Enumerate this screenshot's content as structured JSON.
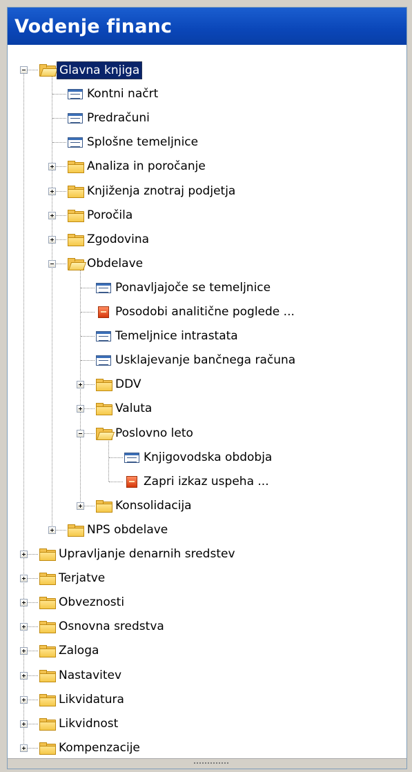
{
  "panel": {
    "title": "Vodenje financ"
  },
  "tree": {
    "items": [
      {
        "label": "Glavna knjiga",
        "level": 0,
        "kind": "folder-open",
        "expander": "minus",
        "selected": true
      },
      {
        "label": "Kontni načrt",
        "level": 1,
        "kind": "form"
      },
      {
        "label": "Predračuni",
        "level": 1,
        "kind": "form"
      },
      {
        "label": "Splošne temeljnice",
        "level": 1,
        "kind": "form"
      },
      {
        "label": "Analiza in poročanje",
        "level": 1,
        "kind": "folder",
        "expander": "plus"
      },
      {
        "label": "Knjiženja znotraj podjetja",
        "level": 1,
        "kind": "folder",
        "expander": "plus"
      },
      {
        "label": "Poročila",
        "level": 1,
        "kind": "folder",
        "expander": "plus"
      },
      {
        "label": "Zgodovina",
        "level": 1,
        "kind": "folder",
        "expander": "plus"
      },
      {
        "label": "Obdelave",
        "level": 1,
        "kind": "folder-open",
        "expander": "minus"
      },
      {
        "label": "Ponavljajoče se temeljnice",
        "level": 2,
        "kind": "form"
      },
      {
        "label": "Posodobi analitične poglede ...",
        "level": 2,
        "kind": "report"
      },
      {
        "label": "Temeljnice intrastata",
        "level": 2,
        "kind": "form"
      },
      {
        "label": "Usklajevanje bančnega  računa",
        "level": 2,
        "kind": "form"
      },
      {
        "label": "DDV",
        "level": 2,
        "kind": "folder",
        "expander": "plus"
      },
      {
        "label": "Valuta",
        "level": 2,
        "kind": "folder",
        "expander": "plus"
      },
      {
        "label": "Poslovno leto",
        "level": 2,
        "kind": "folder-open",
        "expander": "minus"
      },
      {
        "label": "Knjigovodska obdobja",
        "level": 3,
        "kind": "form"
      },
      {
        "label": "Zapri izkaz uspeha ...",
        "level": 3,
        "kind": "report"
      },
      {
        "label": "Konsolidacija",
        "level": 2,
        "kind": "folder",
        "expander": "plus"
      },
      {
        "label": "NPS obdelave",
        "level": 1,
        "kind": "folder",
        "expander": "plus"
      },
      {
        "label": "Upravljanje denarnih sredstev",
        "level": 0,
        "kind": "folder",
        "expander": "plus"
      },
      {
        "label": "Terjatve",
        "level": 0,
        "kind": "folder",
        "expander": "plus"
      },
      {
        "label": "Obveznosti",
        "level": 0,
        "kind": "folder",
        "expander": "plus"
      },
      {
        "label": "Osnovna sredstva",
        "level": 0,
        "kind": "folder",
        "expander": "plus"
      },
      {
        "label": "Zaloga",
        "level": 0,
        "kind": "folder",
        "expander": "plus"
      },
      {
        "label": "Nastavitev",
        "level": 0,
        "kind": "folder",
        "expander": "plus"
      },
      {
        "label": "Likvidatura",
        "level": 0,
        "kind": "folder",
        "expander": "plus"
      },
      {
        "label": "Likvidnost",
        "level": 0,
        "kind": "folder",
        "expander": "plus"
      },
      {
        "label": "Kompenzacije",
        "level": 0,
        "kind": "folder",
        "expander": "plus"
      }
    ]
  },
  "icons": {
    "folder": "folder-icon",
    "folder-open": "folder-open-icon",
    "form": "form-icon",
    "report": "report-icon"
  },
  "colors": {
    "title_bar": "#0a46b8",
    "selection": "#0a246a",
    "folder": "#f2c14e"
  }
}
